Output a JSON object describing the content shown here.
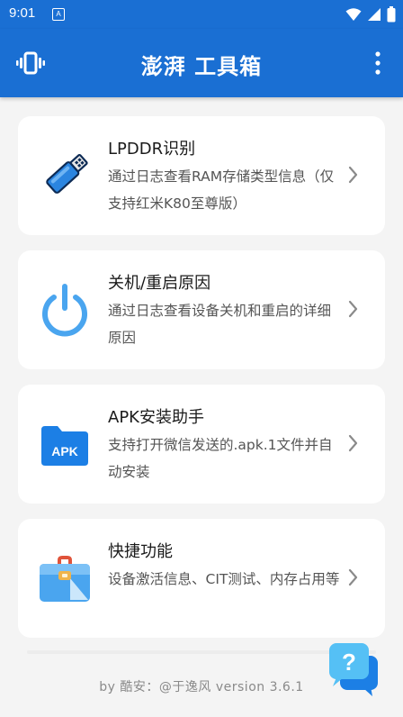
{
  "status": {
    "time": "9:01",
    "notif_label": "A",
    "icons": [
      "wifi-icon",
      "cellular-signal-icon",
      "battery-icon"
    ]
  },
  "appbar": {
    "title": "澎湃 工具箱",
    "left_icon": "vibrate-icon",
    "menu_icon": "more-vert-icon"
  },
  "items": [
    {
      "title": "LPDDR识别",
      "desc": "通过日志查看RAM存储类型信息（仅支持红米K80至尊版）",
      "icon": "usb-drive-icon"
    },
    {
      "title": "关机/重启原因",
      "desc": "通过日志查看设备关机和重启的详细原因",
      "icon": "power-icon"
    },
    {
      "title": "APK安装助手",
      "desc": "支持打开微信发送的.apk.1文件并自动安装",
      "icon": "apk-folder-icon",
      "icon_text": "APK"
    },
    {
      "title": "快捷功能",
      "desc": "设备激活信息、CIT测试、内存占用等",
      "icon": "toolbox-icon"
    }
  ],
  "footer": "by 酷安：@于逸风 version 3.6.1",
  "help_fab": {
    "icon": "help-chat-icon",
    "label": "?"
  },
  "colors": {
    "primary": "#1a6fd3",
    "background": "#f4f4f4",
    "card": "#ffffff"
  }
}
